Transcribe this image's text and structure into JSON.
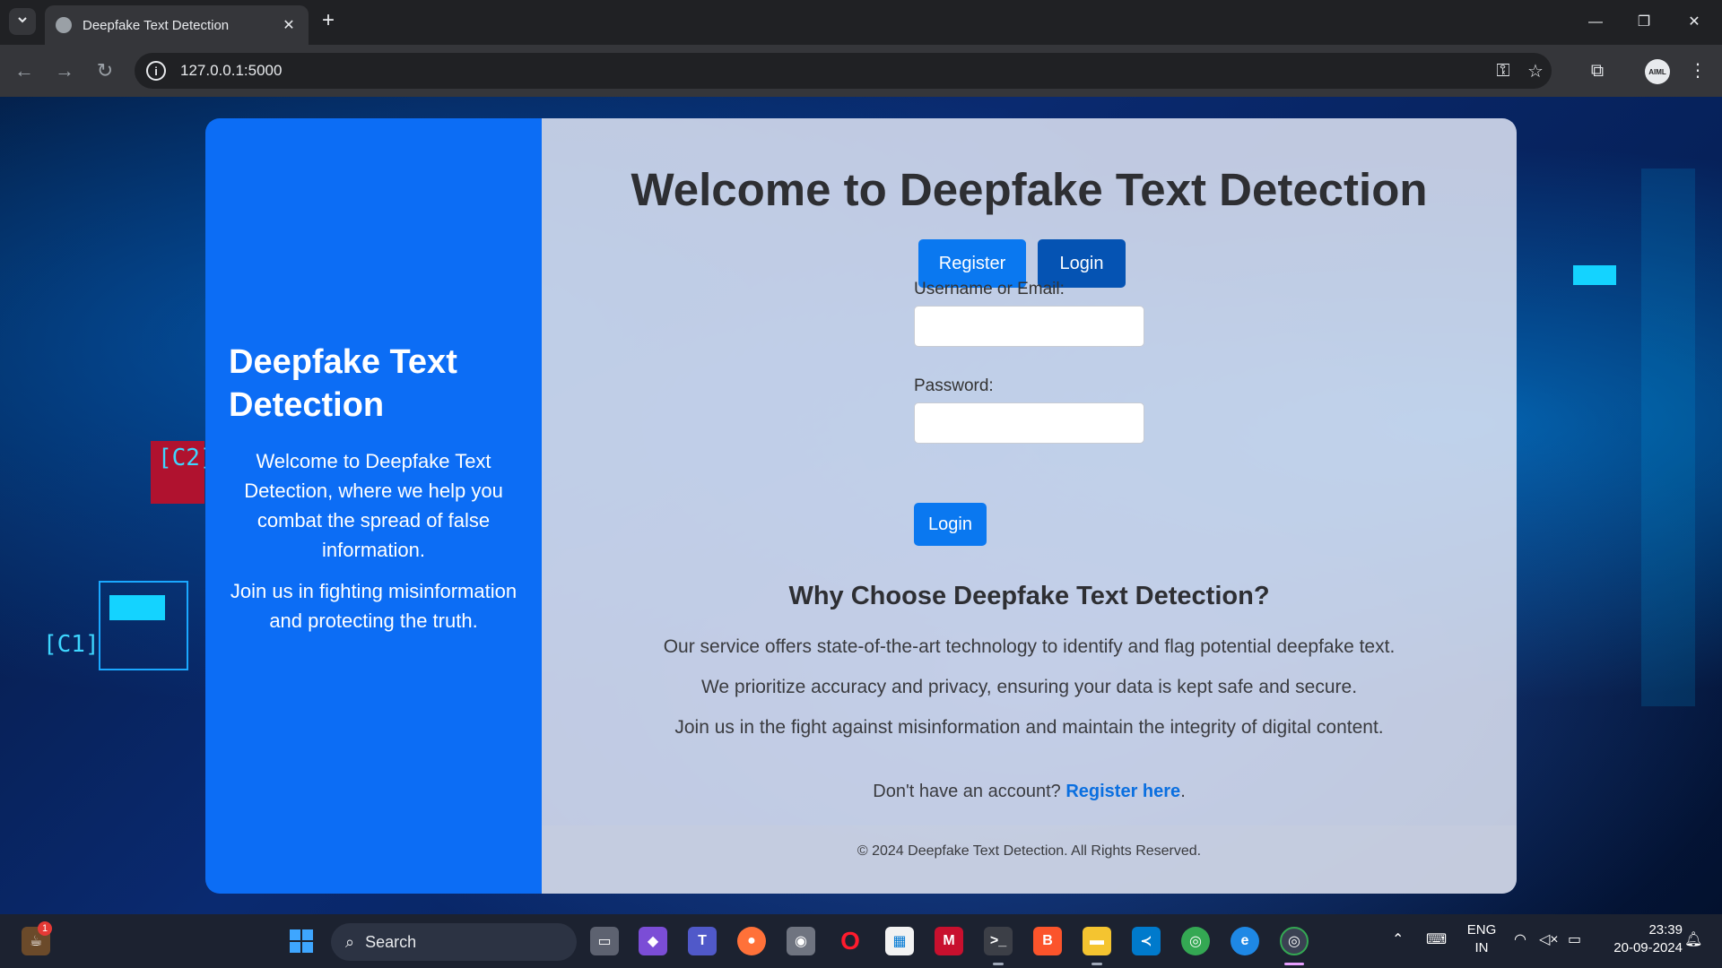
{
  "browser": {
    "tab_title": "Deepfake Text Detection",
    "tab_close": "✕",
    "new_tab": "+",
    "url": "127.0.0.1:5000",
    "window_controls": {
      "minimize": "—",
      "restore": "❐",
      "close": "✕"
    },
    "profile_initials": "AIML"
  },
  "sidebar": {
    "title": "Deepfake Text Detection",
    "intro": "Welcome to Deepfake Text Detection, where we help you combat the spread of false information.",
    "cta": "Join us in fighting misinformation and protecting the truth."
  },
  "main": {
    "heading": "Welcome to Deepfake Text Detection",
    "register_button": "Register",
    "login_tab_button": "Login",
    "username_label": "Username or Email:",
    "username_value": "",
    "password_label": "Password:",
    "password_value": "",
    "submit_button": "Login",
    "why_heading": "Why Choose Deepfake Text Detection?",
    "why_points": [
      "Our service offers state-of-the-art technology to identify and flag potential deepfake text.",
      "We prioritize accuracy and privacy, ensuring your data is kept safe and secure.",
      "Join us in the fight against misinformation and maintain the integrity of digital content."
    ],
    "signup_prompt": "Don't have an account?",
    "signup_link": "Register here",
    "signup_period": ".",
    "footer": "© 2024 Deepfake Text Detection. All Rights Reserved."
  },
  "taskbar": {
    "search_label": "Search",
    "notification_count": "1",
    "language": "ENG",
    "region": "IN",
    "time": "23:39",
    "date": "20-09-2024"
  },
  "colors": {
    "primary": "#0a78f0",
    "primary_dark": "#0553b3",
    "sidebar_bg": "#0c6df5",
    "link": "#0a6fe0"
  }
}
